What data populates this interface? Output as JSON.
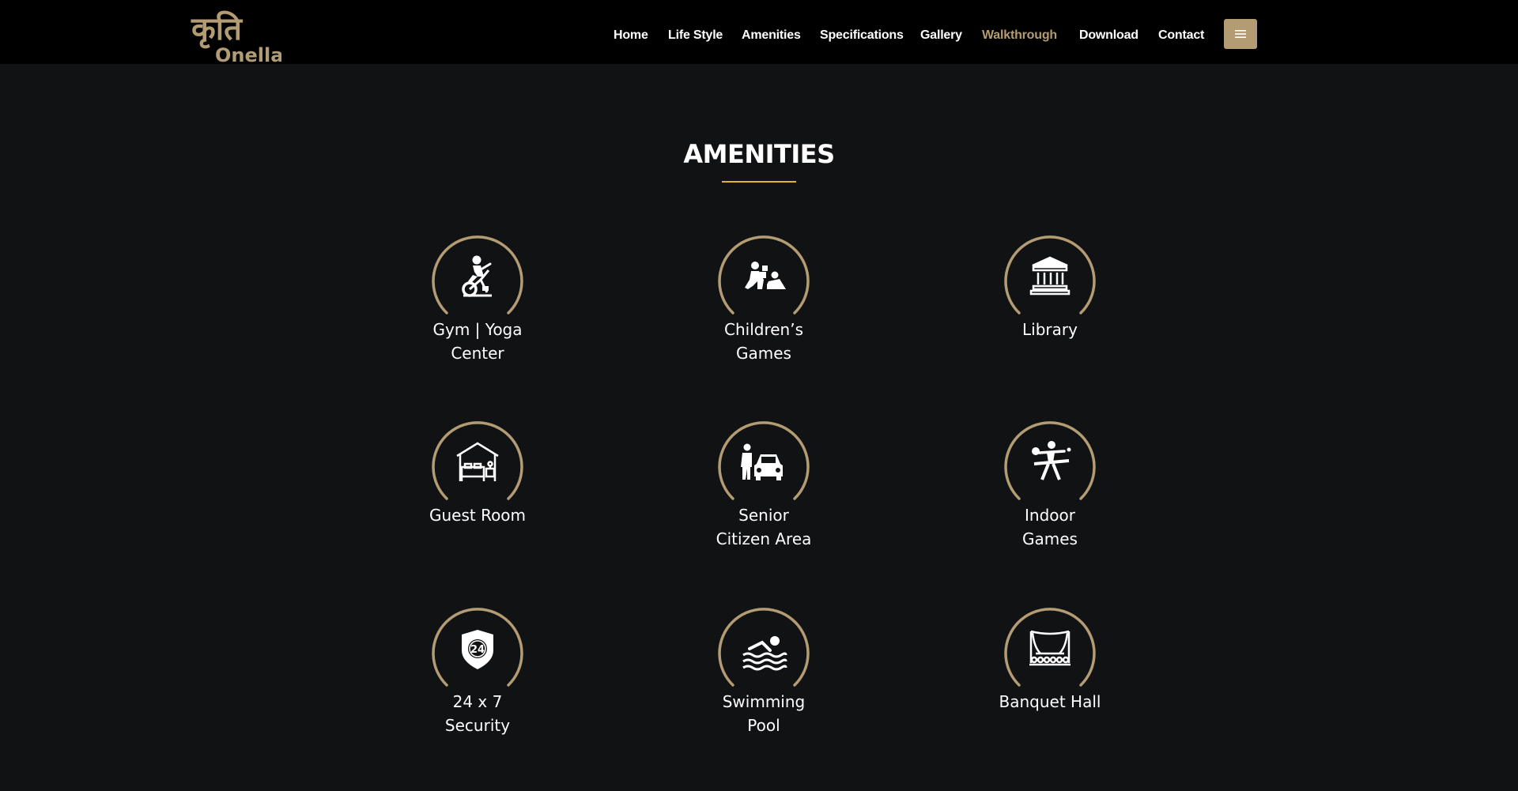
{
  "brand": {
    "logo_devanagari": "कृति",
    "logo_latin": "Onella",
    "accent_color": "#b39c73"
  },
  "nav": {
    "items": [
      {
        "label": "Home",
        "active": false
      },
      {
        "label": "Life Style",
        "active": false
      },
      {
        "label": "Amenities",
        "active": false
      },
      {
        "label": "Specifications",
        "active": false
      },
      {
        "label": "Gallery",
        "active": false
      },
      {
        "label": "Walkthrough",
        "active": true
      },
      {
        "label": "Download",
        "active": false
      },
      {
        "label": "Contact",
        "active": false
      }
    ],
    "menu_icon": "hamburger-icon"
  },
  "section": {
    "title": "AMENITIES",
    "underline_color": "#e0b823"
  },
  "amenities": [
    {
      "lines": [
        "Gym | Yoga",
        "Center"
      ],
      "icon": "exercise-bike-icon"
    },
    {
      "lines": [
        "Children’s",
        "Games"
      ],
      "icon": "children-play-icon"
    },
    {
      "lines": [
        "Library"
      ],
      "icon": "library-building-icon"
    },
    {
      "lines": [
        "Guest Room"
      ],
      "icon": "guest-room-bed-icon"
    },
    {
      "lines": [
        "Senior",
        "Citizen Area"
      ],
      "icon": "senior-citizen-car-icon"
    },
    {
      "lines": [
        "Indoor",
        "Games"
      ],
      "icon": "table-tennis-icon"
    },
    {
      "lines": [
        "24 x 7",
        "Security"
      ],
      "icon": "security-shield-24-icon"
    },
    {
      "lines": [
        "Swimming",
        "Pool"
      ],
      "icon": "swimmer-icon"
    },
    {
      "lines": [
        "Banquet Hall"
      ],
      "icon": "banquet-stage-icon"
    }
  ]
}
